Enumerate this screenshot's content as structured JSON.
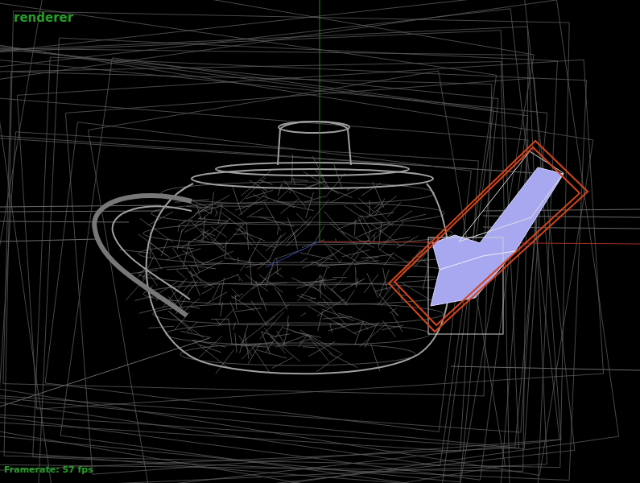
{
  "window": {
    "title": "renderer"
  },
  "viewport": {
    "selection": {
      "visible": true
    }
  },
  "status_bar": {
    "framerate": "Framerate: 57 fps"
  }
}
